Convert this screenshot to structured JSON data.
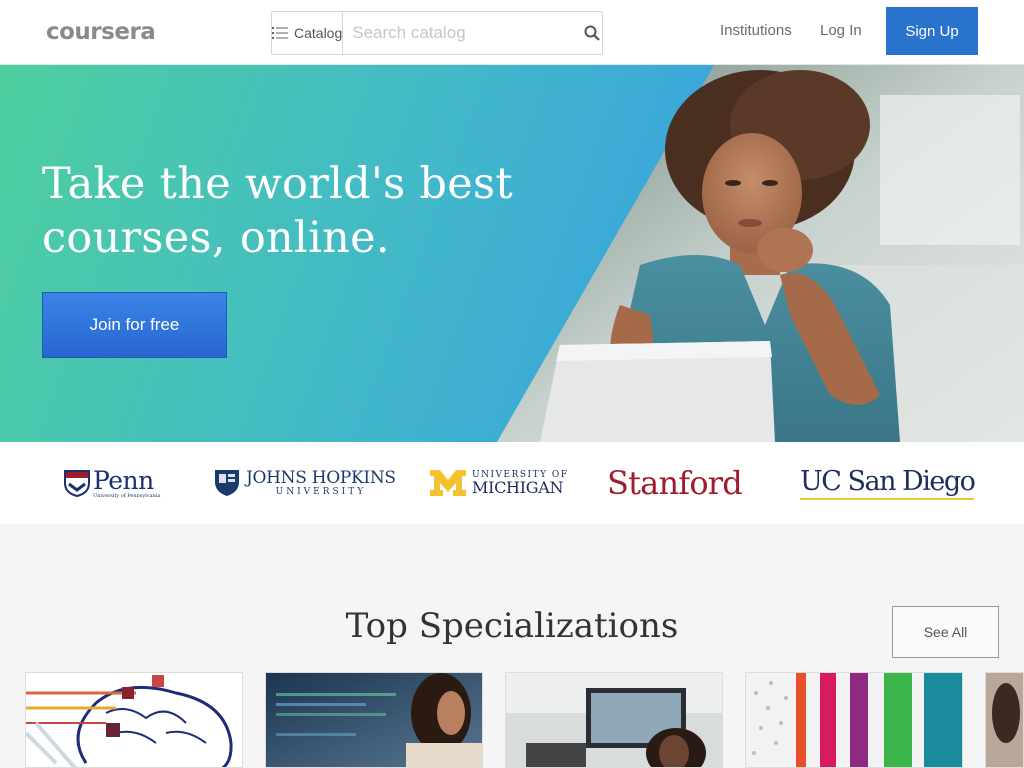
{
  "header": {
    "logo_text": "coursera",
    "catalog_label": "Catalog",
    "search_placeholder": "Search catalog",
    "nav": {
      "institutions": "Institutions",
      "login": "Log In",
      "signup": "Sign Up"
    }
  },
  "hero": {
    "headline_line1": "Take the world's best",
    "headline_line2": "courses, online.",
    "cta_label": "Join for free"
  },
  "partners": {
    "penn": "Penn",
    "penn_sub": "University of Pennsylvania",
    "jhu_top": "JOHNS HOPKINS",
    "jhu_bottom": "UNIVERSITY",
    "umich_top": "UNIVERSITY OF",
    "umich_bottom": "MICHIGAN",
    "stanford": "Stanford",
    "ucsd": "UC San Diego"
  },
  "specializations": {
    "title": "Top Specializations",
    "see_all": "See All"
  },
  "colors": {
    "brand_blue": "#2a73cc",
    "hero_green": "#4ecf9e",
    "hero_blue": "#3498db"
  }
}
